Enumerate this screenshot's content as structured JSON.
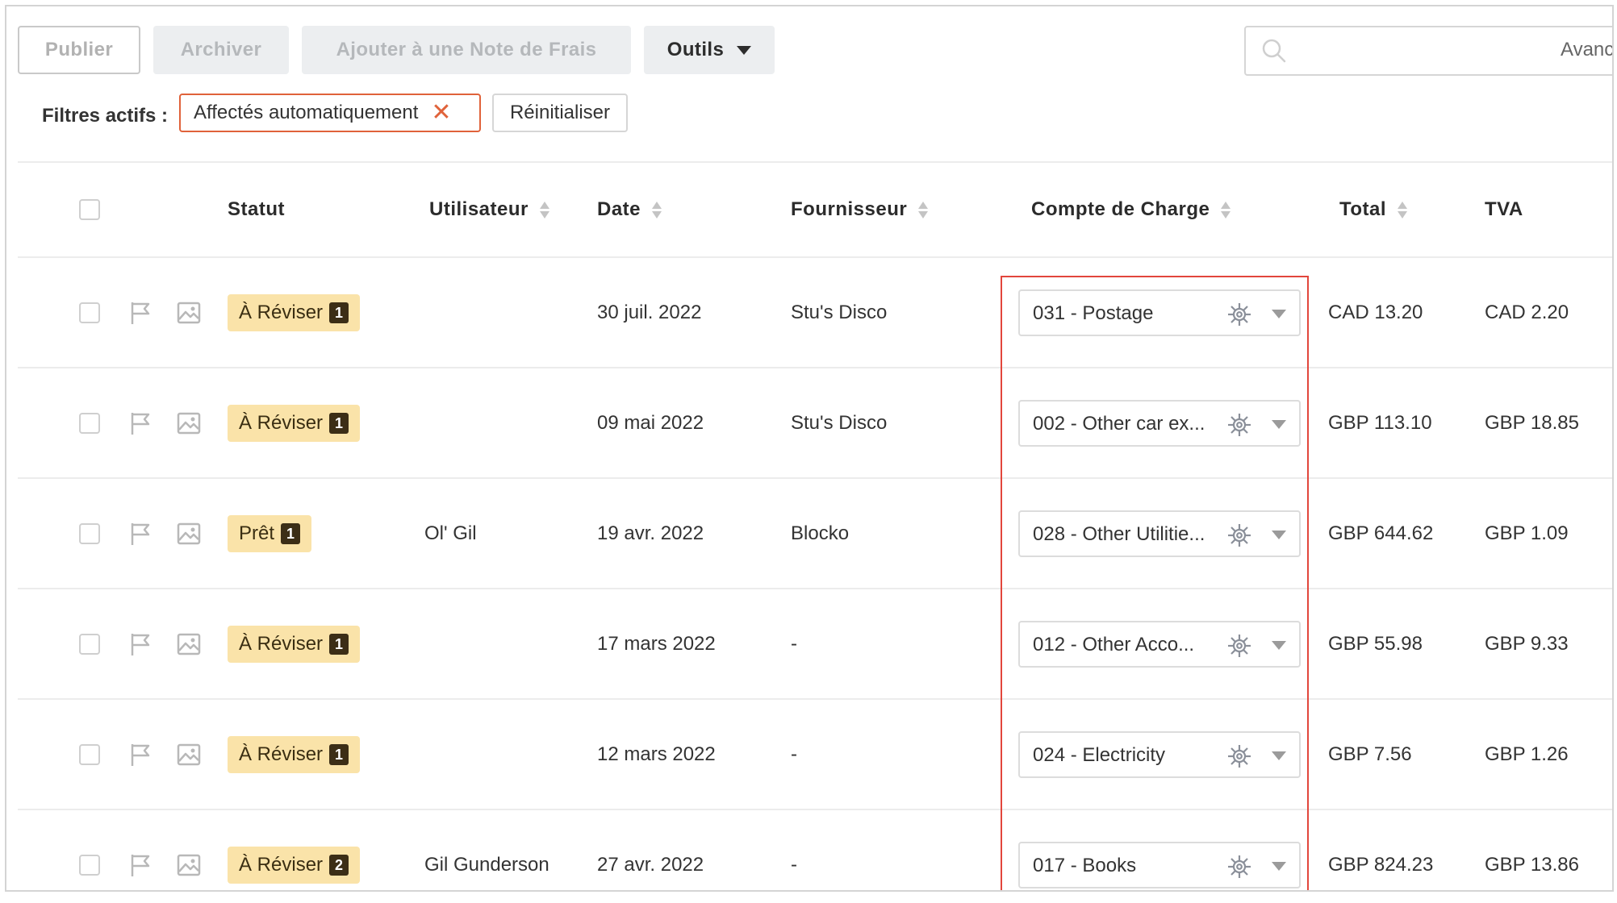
{
  "toolbar": {
    "publish": "Publier",
    "archive": "Archiver",
    "add_expense": "Ajouter à une Note de Frais",
    "tools": "Outils",
    "search_advanced": "Avanc"
  },
  "filters": {
    "label": "Filtres actifs :",
    "chip": "Affectés automatiquement",
    "reset": "Réinitialiser"
  },
  "columns": {
    "status": "Statut",
    "user": "Utilisateur",
    "date": "Date",
    "supplier": "Fournisseur",
    "account": "Compte de Charge",
    "total": "Total",
    "tva": "TVA"
  },
  "rows": [
    {
      "status": "À Réviser",
      "count": "1",
      "user": "",
      "date": "30 juil. 2022",
      "supplier": "Stu's Disco",
      "account": "031 - Postage",
      "total": "CAD 13.20",
      "tva": "CAD 2.20"
    },
    {
      "status": "À Réviser",
      "count": "1",
      "user": "",
      "date": "09 mai 2022",
      "supplier": "Stu's Disco",
      "account": "002 - Other car ex...",
      "total": "GBP 113.10",
      "tva": "GBP 18.85"
    },
    {
      "status": "Prêt",
      "count": "1",
      "user": "Ol' Gil",
      "date": "19 avr. 2022",
      "supplier": "Blocko",
      "account": "028 - Other Utilitie...",
      "total": "GBP 644.62",
      "tva": "GBP 1.09"
    },
    {
      "status": "À Réviser",
      "count": "1",
      "user": "",
      "date": "17 mars 2022",
      "supplier": "-",
      "account": "012 - Other Acco...",
      "total": "GBP 55.98",
      "tva": "GBP 9.33"
    },
    {
      "status": "À Réviser",
      "count": "1",
      "user": "",
      "date": "12 mars 2022",
      "supplier": "-",
      "account": "024 - Electricity",
      "total": "GBP 7.56",
      "tva": "GBP 1.26"
    },
    {
      "status": "À Réviser",
      "count": "2",
      "user": "Gil Gunderson",
      "date": "27 avr. 2022",
      "supplier": "-",
      "account": "017 - Books",
      "total": "GBP 824.23",
      "tva": "GBP 13.86"
    }
  ],
  "icons": {
    "search": "search-icon",
    "tools_dropdown": "chevron-down-icon",
    "filter_remove": "close-icon",
    "sort": "sort-icon",
    "flag": "flag-icon",
    "receipt_image": "image-icon",
    "auto_assign": "gear-icon",
    "account_dropdown": "chevron-down-icon"
  },
  "colors": {
    "status_badge": "#fae3a9",
    "status_count": "#3c2e16",
    "filter_chip_border": "#e0623a",
    "highlight_border": "#e2463c"
  }
}
